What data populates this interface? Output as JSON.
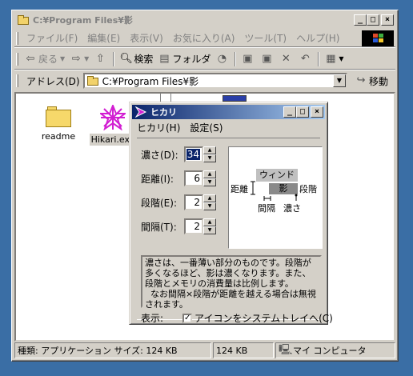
{
  "explorer": {
    "title": "C:¥Program Files¥影",
    "menu": [
      "ファイル(F)",
      "編集(E)",
      "表示(V)",
      "お気に入り(A)",
      "ツール(T)",
      "ヘルプ(H)"
    ],
    "toolbar": {
      "back": "戻る",
      "search": "検索",
      "folders": "フォルダ"
    },
    "address": {
      "label": "アドレス(D)",
      "value": "C:¥Program Files¥影",
      "go": "移動"
    },
    "files": [
      {
        "name": "readme",
        "icon": "folder-icon"
      },
      {
        "name": "Hikari.exe",
        "icon": "hikari-star-icon",
        "selected": true
      }
    ],
    "status": {
      "type_size": "種類: アプリケーション サイズ: 124 KB",
      "size": "124 KB",
      "location": "マイ コンピュータ"
    }
  },
  "dialog": {
    "title": "ヒカリ",
    "menu": [
      "ヒカリ(H)",
      "設定(S)"
    ],
    "fields": [
      {
        "label": "濃さ(D):",
        "value": "34",
        "selected": true
      },
      {
        "label": "距離(I):",
        "value": "6"
      },
      {
        "label": "段階(E):",
        "value": "2"
      },
      {
        "label": "間隔(T):",
        "value": "2"
      }
    ],
    "preview": {
      "window": "ウィンドウ",
      "shadow": "影",
      "distance": "距離",
      "steps": "段階",
      "interval": "間隔",
      "darkness": "濃さ"
    },
    "description": "濃さは、一番薄い部分のものです。段階が多くなるほど、影は濃くなります。また、段階とメモリの消費量は比例します。\n  なお間隔×段階が距離を越える場合は無視されます。",
    "show_label": "表示:",
    "tray_checkbox": "アイコンをシステムトレイへ(C)",
    "tray_checked": true
  }
}
